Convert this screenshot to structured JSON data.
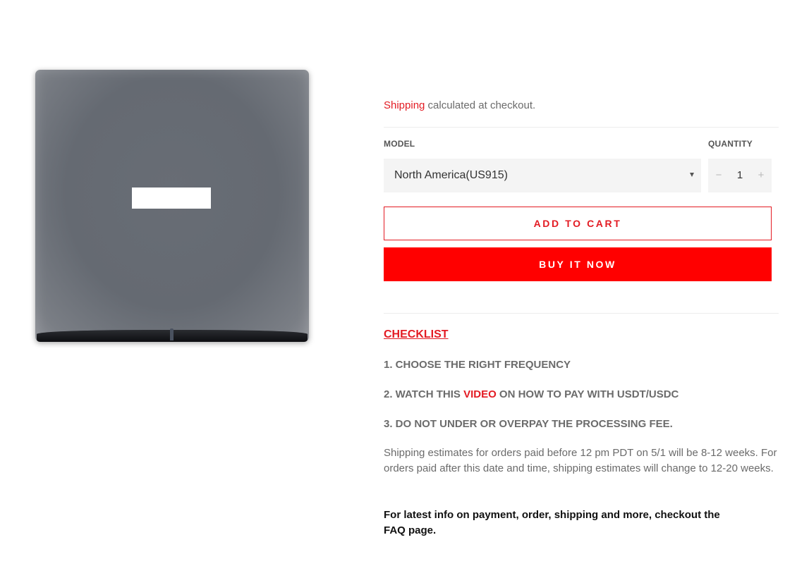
{
  "product": {
    "image_alt": "Gray square device with white label"
  },
  "shipping": {
    "link_text": "Shipping",
    "rest_text": " calculated at checkout."
  },
  "model": {
    "label": "MODEL",
    "selected": "North America(US915)"
  },
  "quantity": {
    "label": "QUANTITY",
    "minus": "−",
    "value": "1",
    "plus": "+"
  },
  "buttons": {
    "add_to_cart": "ADD TO CART",
    "buy_it_now": "BUY IT NOW"
  },
  "checklist": {
    "title": "CHECKLIST",
    "step1": "1. CHOOSE THE RIGHT FREQUENCY",
    "step2_before": "2. WATCH THIS ",
    "step2_link": "VIDEO",
    "step2_after": " ON HOW TO PAY WITH USDT/USDC",
    "step3": "3. DO NOT UNDER OR OVERPAY THE PROCESSING FEE."
  },
  "estimate_text": "Shipping estimates for orders paid before 12 pm PDT on 5/1 will be 8-12 weeks. For orders paid after this date and time, shipping estimates will change to 12-20 weeks.",
  "faq_text": "For latest info on payment, order, shipping and more, checkout the FAQ page.",
  "colors": {
    "accent": "#e31b23",
    "buy_button": "#ff0000",
    "muted_text": "#6b6b6b",
    "field_bg": "#f4f4f4"
  }
}
